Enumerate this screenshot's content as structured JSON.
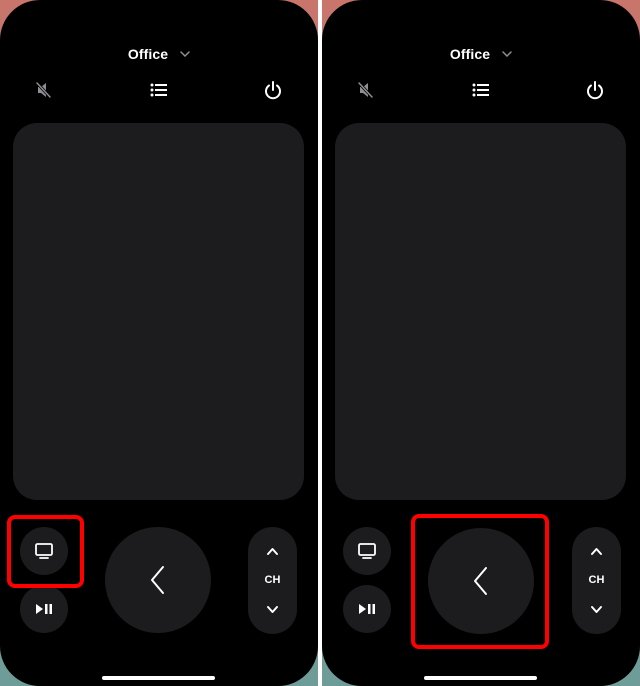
{
  "screens": [
    {
      "device_name": "Office",
      "top_controls": {
        "mute": "mute-icon",
        "guide": "list-icon",
        "power": "power-icon"
      },
      "buttons": {
        "tv": "tv-icon",
        "play_pause": "play-pause-icon",
        "back": "chevron-left-icon",
        "channel_label": "CH",
        "channel_up": "chevron-up-icon",
        "channel_down": "chevron-down-icon"
      },
      "highlighted": "tv-button"
    },
    {
      "device_name": "Office",
      "top_controls": {
        "mute": "mute-icon",
        "guide": "list-icon",
        "power": "power-icon"
      },
      "buttons": {
        "tv": "tv-icon",
        "play_pause": "play-pause-icon",
        "back": "chevron-left-icon",
        "channel_label": "CH",
        "channel_up": "chevron-up-icon",
        "channel_down": "chevron-down-icon"
      },
      "highlighted": "back-button"
    }
  ],
  "colors": {
    "background": "#000000",
    "button": "#1c1c1e",
    "foreground": "#ffffff",
    "highlight": "#ff0000",
    "wallpaper_top": "#c9756c",
    "wallpaper_bottom": "#6e9c98"
  }
}
